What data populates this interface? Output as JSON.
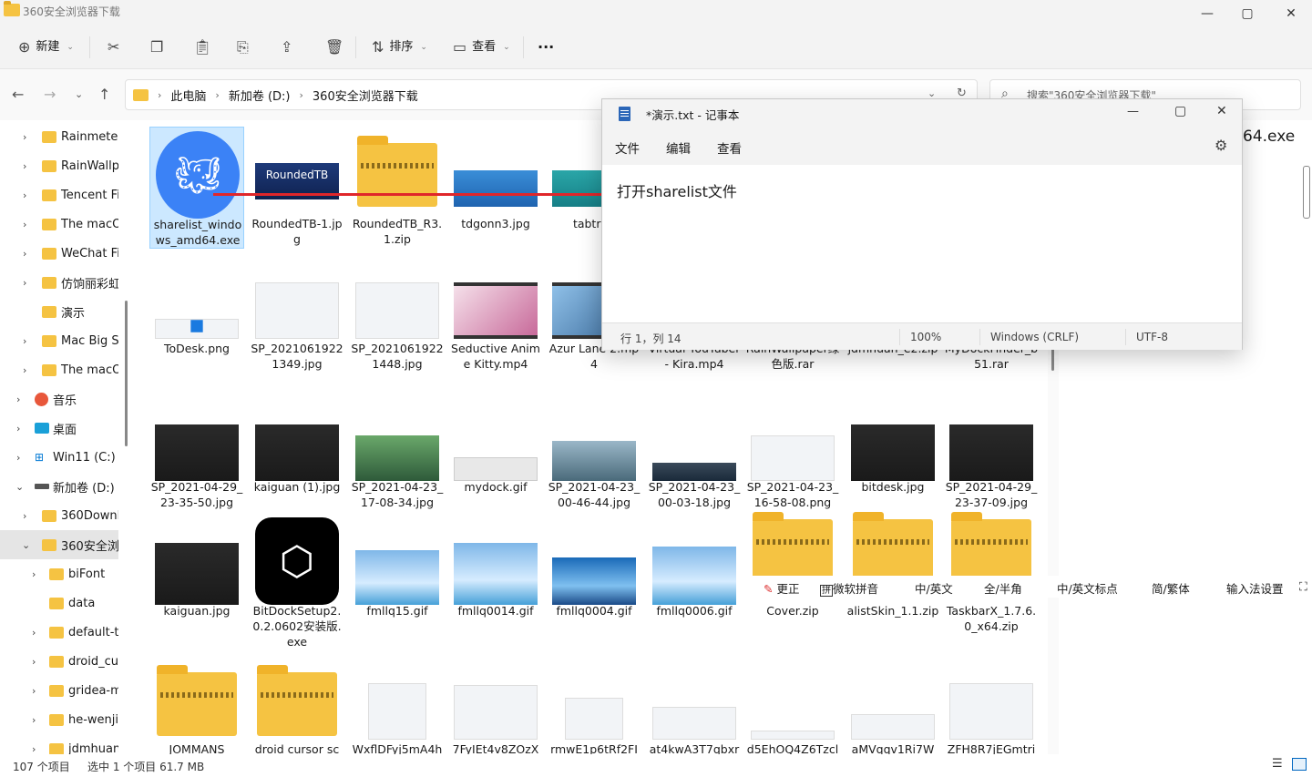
{
  "window": {
    "title": "360安全浏览器下载"
  },
  "toolbar": {
    "new_label": "新建",
    "sort_label": "排序",
    "view_label": "查看",
    "more_label": "···"
  },
  "breadcrumb": [
    "此电脑",
    "新加卷 (D:)",
    "360安全浏览器下载"
  ],
  "search": {
    "placeholder": "搜索\"360安全浏览器下载\""
  },
  "sidebar": {
    "items": [
      {
        "label": "Rainmeter"
      },
      {
        "label": "RainWallpa"
      },
      {
        "label": "Tencent Fil"
      },
      {
        "label": "The macOS"
      },
      {
        "label": "WeChat Fil"
      },
      {
        "label": "仿饷丽彩虹"
      },
      {
        "label": "演示"
      },
      {
        "label": "Mac Big Su"
      },
      {
        "label": "The macOS"
      },
      {
        "label": "音乐"
      },
      {
        "label": "桌面"
      },
      {
        "label": "Win11 (C:)"
      },
      {
        "label": "新加卷 (D:)"
      },
      {
        "label": "360Downlo"
      },
      {
        "label": "360安全浏"
      },
      {
        "label": "biFont"
      },
      {
        "label": "data"
      },
      {
        "label": "default-th"
      },
      {
        "label": "droid_cur"
      },
      {
        "label": "gridea-m"
      },
      {
        "label": "he-wenjie"
      },
      {
        "label": "jdmhuan"
      }
    ]
  },
  "files": [
    {
      "name": "sharelist_windows_amd64.exe"
    },
    {
      "name": "RoundedTB-1.jpg",
      "thumb_text": "RoundedTB"
    },
    {
      "name": "RoundedTB_R3.1.zip"
    },
    {
      "name": "tdgonn3.jpg"
    },
    {
      "name": "tabtran"
    },
    {
      "name": "ToDesk.png"
    },
    {
      "name": "SP_20210619221349.jpg"
    },
    {
      "name": "SP_20210619221448.jpg"
    },
    {
      "name": "Seductive Anime Kitty.mp4"
    },
    {
      "name": "Azur Lane 2.mp4"
    },
    {
      "name": "Virtual YouTuber - Kira.mp4"
    },
    {
      "name": "RainWallpaper绿色版.rar"
    },
    {
      "name": "jdmhuan_e2.zip"
    },
    {
      "name": "MyDockFinder_b51.rar"
    },
    {
      "name": "SP_2021-04-29_23-35-50.jpg"
    },
    {
      "name": "kaiguan (1).jpg"
    },
    {
      "name": "SP_2021-04-23_17-08-34.jpg"
    },
    {
      "name": "mydock.gif"
    },
    {
      "name": "SP_2021-04-23_00-46-44.jpg"
    },
    {
      "name": "SP_2021-04-23_00-03-18.jpg"
    },
    {
      "name": "SP_2021-04-23_16-58-08.png"
    },
    {
      "name": "bitdesk.jpg"
    },
    {
      "name": "SP_2021-04-29_23-37-09.jpg"
    },
    {
      "name": "kaiguan.jpg"
    },
    {
      "name": "BitDockSetup2.0.2.0602安装版.exe"
    },
    {
      "name": "fmllq15.gif"
    },
    {
      "name": "fmllq0014.gif"
    },
    {
      "name": "fmllq0004.gif"
    },
    {
      "name": "fmllq0006.gif"
    },
    {
      "name": "Cover.zip"
    },
    {
      "name": "alistSkin_1.1.zip"
    },
    {
      "name": "TaskbarX_1.7.6.0_x64.zip"
    },
    {
      "name": "JOMMANS"
    },
    {
      "name": "droid cursor sc"
    },
    {
      "name": "WxflDFyj5mA4h"
    },
    {
      "name": "7FyIEt4v8ZOzX"
    },
    {
      "name": "rmwE1p6tRf2FI"
    },
    {
      "name": "at4kwA3T7qbxr"
    },
    {
      "name": "d5EhOQ4Z6Tzcl"
    },
    {
      "name": "aMVqqv1Ri7W"
    },
    {
      "name": "ZFH8R7jEGmtri"
    }
  ],
  "right_peek": {
    "text": "64.exe"
  },
  "statusbar": {
    "count": "107 个项目",
    "selection": "选中 1 个项目  61.7 MB"
  },
  "notepad": {
    "title": "*演示.txt - 记事本",
    "menu": [
      "文件",
      "编辑",
      "查看"
    ],
    "content": "打开sharelist文件",
    "status": {
      "position": "行 1，列 14",
      "zoom": "100%",
      "line_ending": "Windows (CRLF)",
      "encoding": "UTF-8"
    }
  },
  "ime_toolbar": {
    "items": [
      "更正",
      "微软拼音",
      "中/英文",
      "全/半角",
      "中/英文标点",
      "简/繁体",
      "输入法设置"
    ]
  },
  "colors": {
    "accent": "#0067c0",
    "selection": "#cce8ff",
    "folder": "#f5c342",
    "annotation": "#e0262a"
  }
}
